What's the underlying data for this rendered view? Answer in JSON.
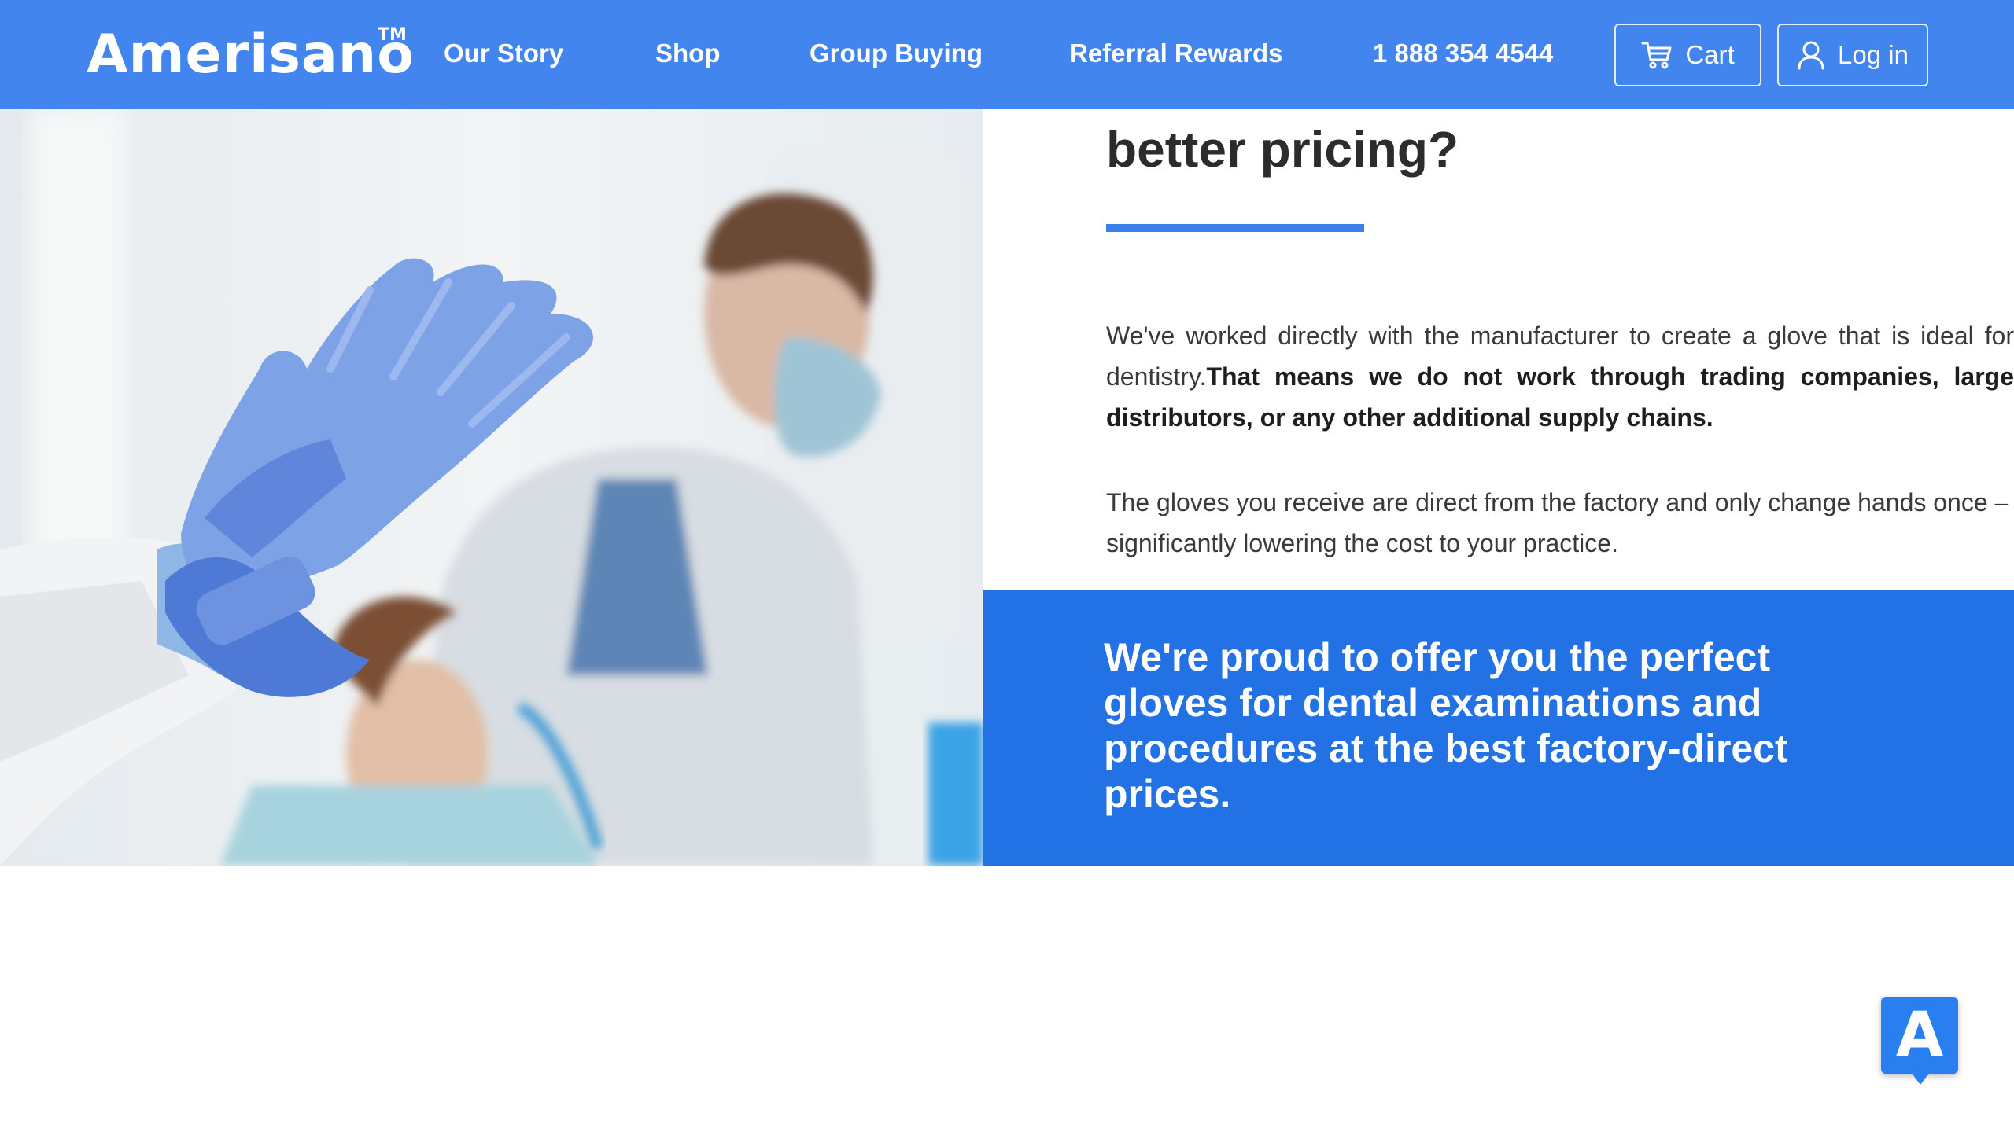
{
  "header": {
    "logo_text": "Amerisano",
    "logo_tm": "TM",
    "nav": [
      {
        "label": "Our Story"
      },
      {
        "label": "Shop"
      },
      {
        "label": "Group Buying"
      },
      {
        "label": "Referral Rewards"
      },
      {
        "label": "1 888 354 4544"
      }
    ],
    "cart_label": "Cart",
    "login_label": "Log in"
  },
  "content": {
    "heading": "better pricing?",
    "para1_start": "We've worked directly with the manufacturer to create a glove that is ideal for dentistry.",
    "para1_bold": "That means we do not work through trading companies, large distributors, or any other additional supply chains.",
    "para2": "The gloves you receive are direct from the factory and only change hands once – significantly lowering the cost to your practice."
  },
  "callout": {
    "text": "We're proud to offer you the perfect gloves for dental examinations and procedures at the best factory-direct prices."
  },
  "badge": {
    "letter": "A"
  },
  "colors": {
    "header_bg": "#4285ee",
    "accent": "#3a80ea",
    "callout_bg": "#2272e6",
    "text_dark": "#2c2c2c"
  },
  "icons": [
    "cart-icon",
    "user-icon"
  ]
}
